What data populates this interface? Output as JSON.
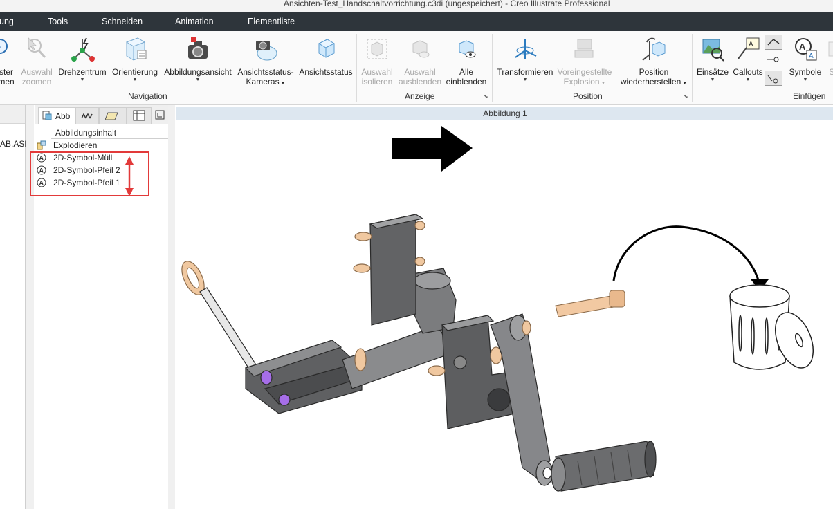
{
  "window": {
    "title": "Ansichten-Test_Handschaltvorrichtung.c3di (ungespeichert) - Creo Illustrate Professional"
  },
  "menu": [
    "ung",
    "Tools",
    "Schneiden",
    "Animation",
    "Elementliste"
  ],
  "ribbon": {
    "buttons": [
      {
        "label1": "ster",
        "label2": "men",
        "icon": "zoom-icon",
        "enabled": true
      },
      {
        "label1": "Auswahl",
        "label2": "zoomen",
        "icon": "zoom-selection-icon",
        "enabled": false
      },
      {
        "label1": "Drehzentrum",
        "label2": "",
        "icon": "spin-center-icon",
        "enabled": true,
        "dropdown": true
      },
      {
        "label1": "Orientierung",
        "label2": "",
        "icon": "orientation-cube-icon",
        "enabled": true,
        "dropdown": true
      },
      {
        "label1": "Abbildungsansicht",
        "label2": "",
        "icon": "camera-icon",
        "enabled": true,
        "dropdown": true
      },
      {
        "label1": "Ansichtsstatus-",
        "label2": "Kameras",
        "icon": "camera-globe-icon",
        "enabled": true,
        "dropdown": true
      },
      {
        "label1": "Ansichtsstatus",
        "label2": "",
        "icon": "view-state-cube-icon",
        "enabled": true
      },
      {
        "label1": "Auswahl",
        "label2": "isolieren",
        "icon": "isolate-icon",
        "enabled": false
      },
      {
        "label1": "Auswahl",
        "label2": "ausblenden",
        "icon": "hide-icon",
        "enabled": false
      },
      {
        "label1": "Alle",
        "label2": "einblenden",
        "icon": "show-all-icon",
        "enabled": true
      },
      {
        "label1": "Transformieren",
        "label2": "",
        "icon": "transform-icon",
        "enabled": true,
        "dropdown": true
      },
      {
        "label1": "Voreingestellte",
        "label2": "Explosion",
        "icon": "preset-explosion-icon",
        "enabled": false,
        "dropdown": true
      },
      {
        "label1": "Position",
        "label2": "wiederherstellen",
        "icon": "restore-position-icon",
        "enabled": true,
        "dropdown": true
      },
      {
        "label1": "Einsätze",
        "label2": "",
        "icon": "inserts-icon",
        "enabled": true,
        "dropdown": true
      },
      {
        "label1": "Callouts",
        "label2": "",
        "icon": "callouts-icon",
        "enabled": true,
        "dropdown": true
      },
      {
        "label1": "Symbole",
        "label2": "",
        "icon": "symbols-icon",
        "enabled": true,
        "dropdown": true
      },
      {
        "label1": "St",
        "label2": "",
        "icon": "partial-icon",
        "enabled": false
      }
    ],
    "groups": [
      "Navigation",
      "Anzeige",
      "Position",
      "Einfügen"
    ]
  },
  "left_panel": {
    "text": "AB.ASM"
  },
  "tree": {
    "tab_label": "Abb",
    "column_header": "Abbildungsinhalt",
    "items": [
      {
        "label": "Explodieren",
        "icon": "explode-icon"
      },
      {
        "label": "2D-Symbol-Müll",
        "icon": "symbol-icon"
      },
      {
        "label": "2D-Symbol-Pfeil 2",
        "icon": "symbol-icon"
      },
      {
        "label": "2D-Symbol-Pfeil 1",
        "icon": "symbol-icon"
      }
    ]
  },
  "viewport": {
    "title": "Abbildung 1"
  },
  "colors": {
    "menubar": "#2e353b",
    "highlight_box": "#e23a3a",
    "viewport_header": "#dde7f0",
    "part_gray": "#6d6e70",
    "part_peach": "#f0c8a0"
  }
}
